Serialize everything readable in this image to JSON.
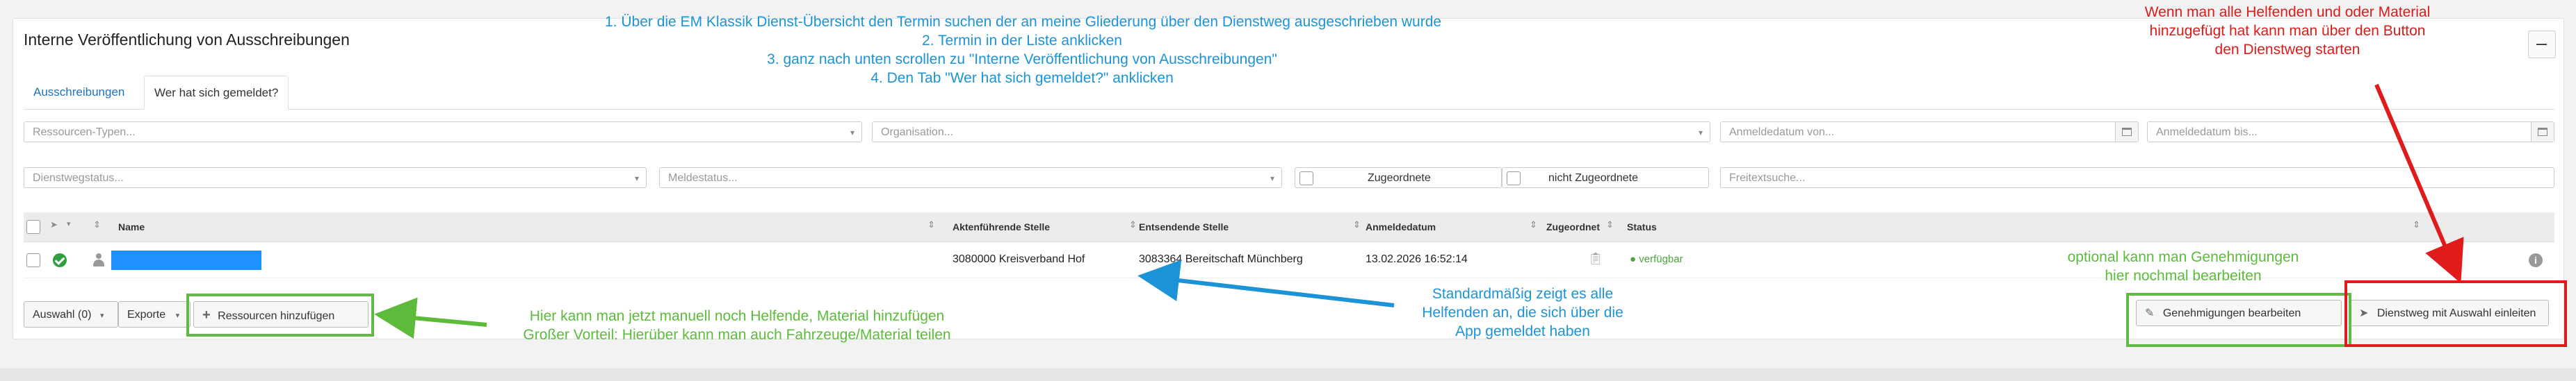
{
  "panel": {
    "title": "Interne Veröffentlichung von Ausschreibungen"
  },
  "tabs": [
    {
      "label": "Ausschreibungen"
    },
    {
      "label": "Wer hat sich gemeldet?"
    }
  ],
  "filters": {
    "ressourcen_typen": "Ressourcen-Typen...",
    "organisation": "Organisation...",
    "anmeldedatum_von": "Anmeldedatum von...",
    "anmeldedatum_bis": "Anmeldedatum bis...",
    "dienstwegstatus": "Dienstwegstatus...",
    "meldestatus": "Meldestatus...",
    "zugeordnete": "Zugeordnete",
    "nicht_zugeordnete": "nicht Zugeordnete",
    "freitextsuche": "Freitextsuche..."
  },
  "table": {
    "headers": {
      "name": "Name",
      "aktenfuehrende": "Aktenführende Stelle",
      "entsendende": "Entsendende Stelle",
      "anmeldedatum": "Anmeldedatum",
      "zugeordnet": "Zugeordnet",
      "status": "Status"
    },
    "rows": [
      {
        "aktenfuehrende": "3080000 Kreisverband Hof",
        "entsendende": "3083364 Bereitschaft Münchberg",
        "anmeldedatum": "13.02.2026 16:52:14",
        "status": "● verfügbar"
      }
    ]
  },
  "footer": {
    "auswahl": "Auswahl (0)",
    "exporte": "Exporte",
    "ressourcen_hinzufuegen": "Ressourcen hinzufügen",
    "genehmigungen_bearbeiten": "Genehmigungen bearbeiten",
    "dienstweg_einleiten": "Dienstweg mit Auswahl einleiten"
  },
  "annotations": {
    "steps": [
      "1. Über die EM Klassik Dienst-Übersicht den Termin suchen der an meine Gliederung über den Dienstweg ausgeschrieben wurde",
      "2. Termin in der Liste anklicken",
      "3. ganz nach unten scrollen zu \"Interne Veröffentlichung von Ausschreibungen\"",
      "4. Den Tab \"Wer hat sich gemeldet?\" anklicken"
    ],
    "red_note": [
      "Wenn man alle Helfenden und oder Material",
      "hinzugefügt hat kann man über den Button",
      "den Dienstweg starten"
    ],
    "blue_note": [
      "Standardmäßig zeigt es alle",
      "Helfenden an, die sich über die",
      "App gemeldet haben"
    ],
    "green_left": [
      "Hier kann man jetzt manuell noch Helfende, Material hinzufügen",
      "Großer Vorteil: Hierüber kann man auch Fahrzeuge/Material teilen"
    ],
    "green_right": [
      "optional kann man Genehmigungen",
      "hier nochmal bearbeiten"
    ]
  },
  "colors": {
    "accent_blue": "#1c93d6",
    "annotation_green": "#5cbb3b",
    "annotation_red": "#dd1b1b",
    "link_blue": "#1e73c0"
  }
}
